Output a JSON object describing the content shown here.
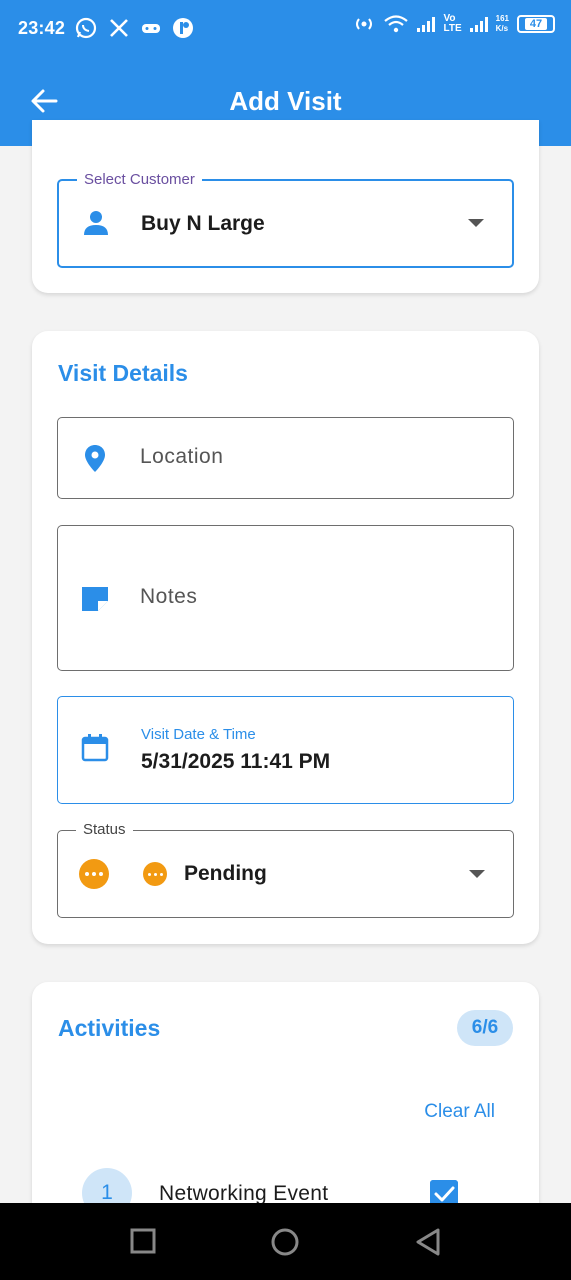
{
  "status_bar": {
    "time": "23:42",
    "volte": "Vo\nLTE",
    "speed": "161\nK/s",
    "battery": "47"
  },
  "appbar": {
    "title": "Add Visit",
    "back_icon": "arrow-left-icon"
  },
  "customer": {
    "label": "Select Customer",
    "value": "Buy N Large",
    "icon": "person-icon"
  },
  "visit_details": {
    "title": "Visit Details",
    "location_placeholder": "Location",
    "notes_placeholder": "Notes",
    "datetime_label": "Visit Date & Time",
    "datetime_value": "5/31/2025 11:41 PM",
    "status_label": "Status",
    "status_value": "Pending",
    "status_color": "#f29a12"
  },
  "activities": {
    "title": "Activities",
    "count": "6/6",
    "clear_all": "Clear All",
    "items": [
      {
        "number": "1",
        "label": "Networking Event",
        "checked": true
      }
    ]
  },
  "colors": {
    "primary": "#2b8ee8",
    "badge_bg": "#cfe5f8",
    "floating_label": "#6a4fa0"
  }
}
